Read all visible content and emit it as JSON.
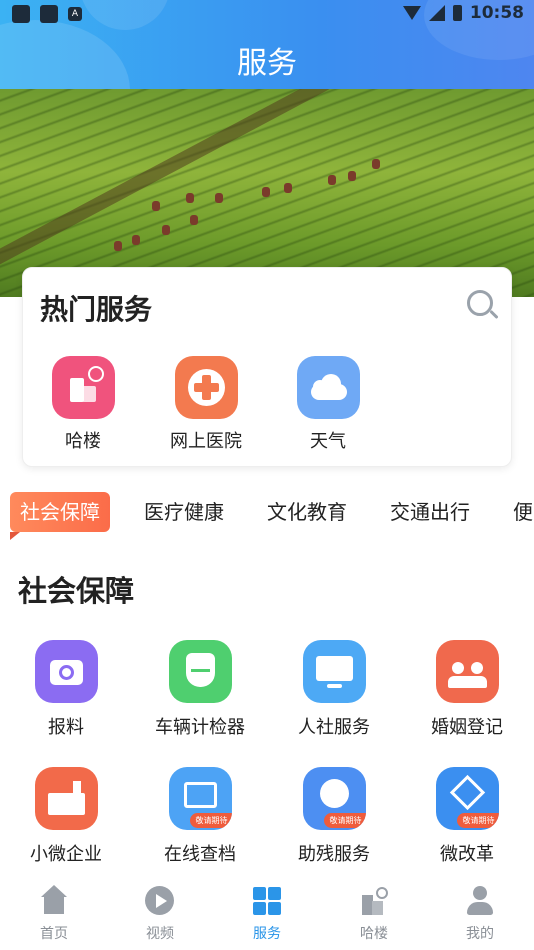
{
  "status_bar": {
    "time": "10:58",
    "notification_icon": "A"
  },
  "header": {
    "title": "服务"
  },
  "hot_services": {
    "title": "热门服务",
    "items": [
      {
        "label": "哈楼",
        "icon": "building-icon",
        "color": "#f0537d"
      },
      {
        "label": "网上医院",
        "icon": "medical-cross-icon",
        "color": "#f37a4f"
      },
      {
        "label": "天气",
        "icon": "cloud-icon",
        "color": "#6fa9f5"
      }
    ]
  },
  "tabs": [
    "社会保障",
    "医疗健康",
    "文化教育",
    "交通出行",
    "便"
  ],
  "section": {
    "title": "社会保障"
  },
  "grid": [
    {
      "label": "报料",
      "icon": "camera-icon",
      "color": "#8b6cf2"
    },
    {
      "label": "车辆计检器",
      "icon": "shield-pulse-icon",
      "color": "#4fcf6f"
    },
    {
      "label": "人社服务",
      "icon": "monitor-icon",
      "color": "#4da9f5"
    },
    {
      "label": "婚姻登记",
      "icon": "couple-icon",
      "color": "#f0694d"
    },
    {
      "label": "小微企业",
      "icon": "factory-icon",
      "color": "#f26a4a"
    },
    {
      "label": "在线查档",
      "icon": "archive-icon",
      "color": "#4da3f5",
      "badge": "敬请期待"
    },
    {
      "label": "助残服务",
      "icon": "accessibility-icon",
      "color": "#4d8ff2",
      "badge": "敬请期待"
    },
    {
      "label": "微改革",
      "icon": "diamond-icon",
      "color": "#3b8ff0",
      "badge": "敬请期待"
    }
  ],
  "bottom_nav": [
    {
      "label": "首页",
      "icon": "home-icon"
    },
    {
      "label": "视频",
      "icon": "play-icon"
    },
    {
      "label": "服务",
      "icon": "grid-icon",
      "active": true
    },
    {
      "label": "哈楼",
      "icon": "building-icon"
    },
    {
      "label": "我的",
      "icon": "user-icon"
    }
  ],
  "colors": {
    "header": "#3a9ff2",
    "active_tab": "#fb6c49",
    "active_nav": "#2b95e8"
  }
}
